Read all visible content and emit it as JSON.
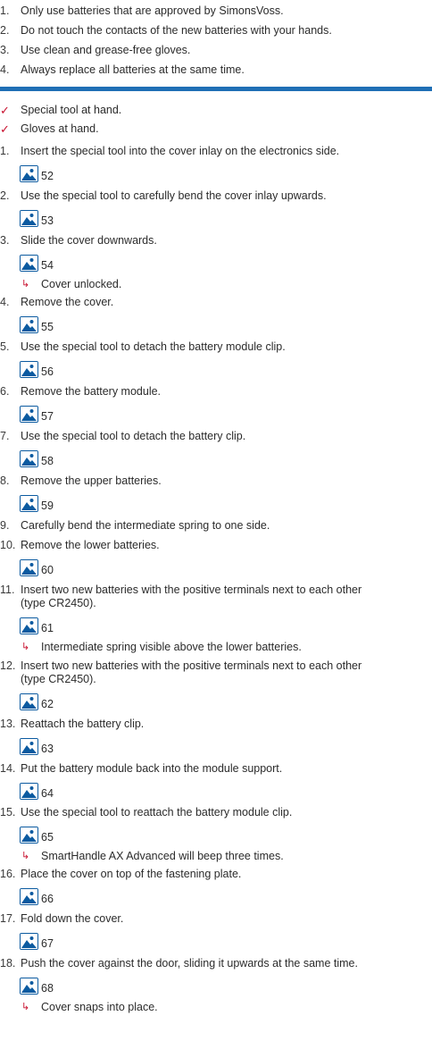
{
  "notices": [
    {
      "num": "1.",
      "text": "Only use batteries that are approved by SimonsVoss."
    },
    {
      "num": "2.",
      "text": "Do not touch the contacts of the new batteries with your hands."
    },
    {
      "num": "3.",
      "text": "Use clean and grease-free gloves."
    },
    {
      "num": "4.",
      "text": "Always replace all batteries at the same time."
    }
  ],
  "prerequisites": [
    {
      "icon": "check-icon",
      "mark": "✓",
      "text": "Special tool at hand."
    },
    {
      "icon": "check-icon",
      "mark": "✓",
      "text": "Gloves at hand."
    }
  ],
  "steps": [
    {
      "num": "1.",
      "text": "Insert the special tool into the cover inlay on the electronics side.",
      "figure": "52"
    },
    {
      "num": "2.",
      "text": "Use the special tool to carefully bend the cover inlay upwards.",
      "figure": "53"
    },
    {
      "num": "3.",
      "text": "Slide the cover downwards.",
      "figure": "54",
      "result": "Cover unlocked."
    },
    {
      "num": "4.",
      "text": "Remove the cover.",
      "figure": "55"
    },
    {
      "num": "5.",
      "text": "Use the special tool to detach the battery module clip.",
      "figure": "56"
    },
    {
      "num": "6.",
      "text": "Remove the battery module.",
      "figure": "57"
    },
    {
      "num": "7.",
      "text": "Use the special tool to detach the battery clip.",
      "figure": "58"
    },
    {
      "num": "8.",
      "text": "Remove the upper batteries.",
      "figure": "59"
    },
    {
      "num": "9.",
      "text": "Carefully bend the intermediate spring to one side."
    },
    {
      "num": "10.",
      "text": "Remove the lower batteries.",
      "figure": "60"
    },
    {
      "num": "11.",
      "text": "Insert two new batteries with the positive terminals next to each other",
      "text2": "(type CR2450).",
      "figure": "61",
      "result": "Intermediate spring visible above the lower batteries."
    },
    {
      "num": "12.",
      "text": "Insert two new batteries with the positive terminals next to each other",
      "text2": "(type CR2450).",
      "figure": "62"
    },
    {
      "num": "13.",
      "text": "Reattach the battery clip.",
      "figure": "63"
    },
    {
      "num": "14.",
      "text": "Put the battery module back into the module support.",
      "figure": "64"
    },
    {
      "num": "15.",
      "text": "Use the special tool to reattach the battery module clip.",
      "figure": "65",
      "result": "SmartHandle AX Advanced will beep three times."
    },
    {
      "num": "16.",
      "text": "Place the cover on top of the fastening plate.",
      "figure": "66"
    },
    {
      "num": "17.",
      "text": "Fold down the cover.",
      "figure": "67"
    },
    {
      "num": "18.",
      "text": "Push the cover against the door, sliding it upwards at the same time.",
      "figure": "68",
      "result": "Cover snaps into place."
    }
  ],
  "result_marker": "↳",
  "colors": {
    "accent_rule": "#1f6fb5",
    "check": "#c8102e",
    "image_icon": "#0b5aa0"
  }
}
